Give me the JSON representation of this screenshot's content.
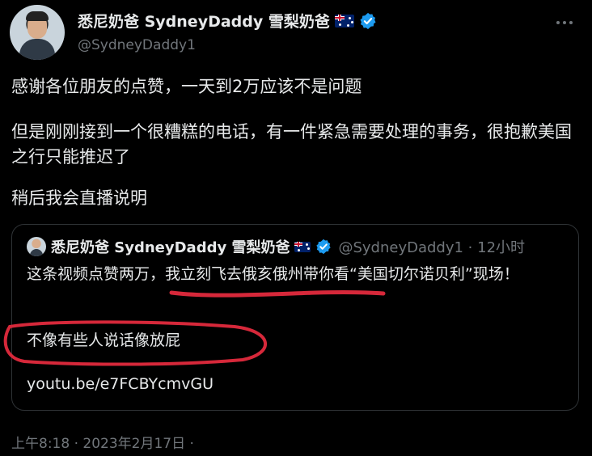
{
  "author": {
    "display_name": "悉尼奶爸 SydneyDaddy 雪梨奶爸",
    "handle": "@SydneyDaddy1"
  },
  "tweet": {
    "paragraph_1": "感谢各位朋友的点赞，一天到2万应该不是问题",
    "paragraph_2": "但是刚刚接到一个很糟糕的电话，有一件紧急需要处理的事务，很抱歉美国之行只能推迟了",
    "paragraph_3": "稍后我会直播说明",
    "timestamp": "上午8:18 · 2023年2月17日 ·"
  },
  "quoted_tweet": {
    "display_name": "悉尼奶爸 SydneyDaddy 雪梨奶爸",
    "meta": "@SydneyDaddy1 · 12小时",
    "text_1": "这条视频点赞两万，我立刻飞去俄亥俄州带你看“美国切尔诺贝利”现场！",
    "text_2": "不像有些人说话像放屁",
    "link": "youtu.be/e7FCBYcmvGU"
  },
  "icons": {
    "flag": "australia-flag-icon",
    "verified": "verified-badge-icon",
    "more": "more-icon"
  },
  "colors": {
    "background": "#000000",
    "text": "#e7e9ea",
    "secondary": "#71767b",
    "verified": "#1d9bf0",
    "annotation": "#d6283a"
  }
}
